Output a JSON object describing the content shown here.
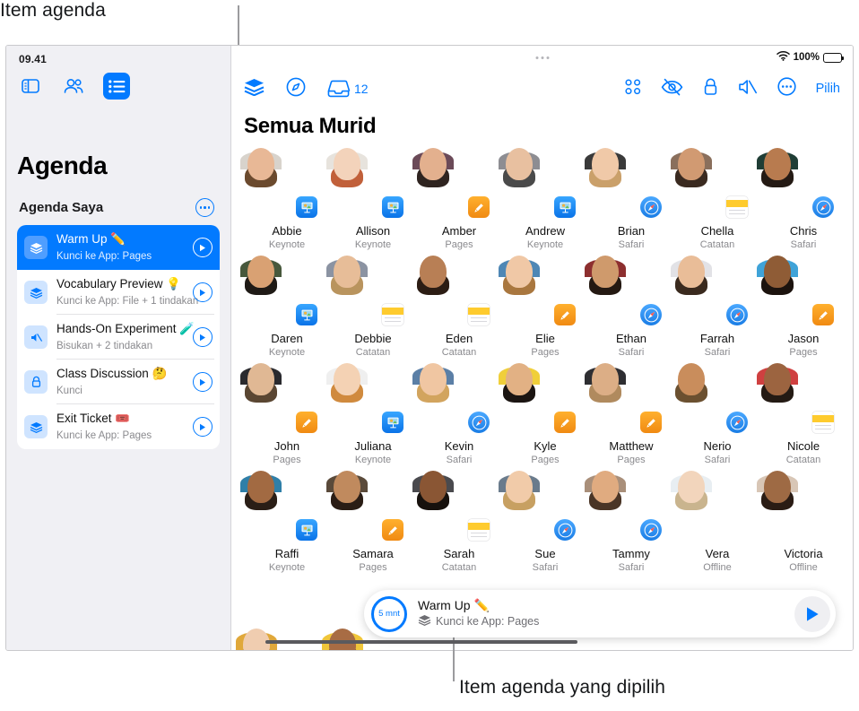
{
  "callouts": {
    "top": "Item agenda",
    "bottom": "Item agenda yang dipilih"
  },
  "sidebar": {
    "status_time": "09.41",
    "toolbar": [
      {
        "name": "sidebar-toggle-icon",
        "label": "Sidebar"
      },
      {
        "name": "people-icon",
        "label": "Murid"
      },
      {
        "name": "list-icon",
        "label": "Agenda"
      }
    ],
    "title": "Agenda",
    "subtitle": "Agenda Saya",
    "more_label": "Lainnya",
    "items": [
      {
        "title": "Warm Up ✏️",
        "subtitle": "Kunci ke App: Pages",
        "icon": "layers-icon",
        "selected": true
      },
      {
        "title": "Vocabulary Preview 💡",
        "subtitle": "Kunci ke App: File + 1 tindakan",
        "icon": "layers-icon",
        "selected": false
      },
      {
        "title": "Hands-On Experiment 🧪",
        "subtitle": "Bisukan + 2 tindakan",
        "icon": "mute-icon",
        "selected": false
      },
      {
        "title": "Class Discussion 🤔",
        "subtitle": "Kunci",
        "icon": "lock-icon",
        "selected": false
      },
      {
        "title": "Exit Ticket 🎟️",
        "subtitle": "Kunci ke App: Pages",
        "icon": "layers-icon",
        "selected": false
      }
    ]
  },
  "main": {
    "status_battery": "100%",
    "toolbar_left": [
      {
        "name": "layers-icon"
      },
      {
        "name": "compass-icon"
      },
      {
        "name": "inbox-icon"
      }
    ],
    "inbox_count": "12",
    "toolbar_right": [
      {
        "name": "grid-view-icon"
      },
      {
        "name": "hide-screen-icon"
      },
      {
        "name": "lock-icon"
      },
      {
        "name": "mute-icon"
      },
      {
        "name": "more-icon"
      }
    ],
    "select_label": "Pilih",
    "title": "Semua Murid",
    "students": [
      {
        "name": "Abbie",
        "app": "Keynote",
        "badge": "keynote",
        "hair": "#6b4a2e",
        "face": "#e8b896",
        "bg": "#9ab98a",
        "body": "#d8d3cc"
      },
      {
        "name": "Allison",
        "app": "Keynote",
        "badge": "keynote",
        "hair": "#c1603a",
        "face": "#f3d3bb",
        "bg": "#b9cfe0",
        "body": "#e7e3dd"
      },
      {
        "name": "Amber",
        "app": "Pages",
        "badge": "pages",
        "hair": "#2f2420",
        "face": "#e3b08e",
        "bg": "#4f5a52",
        "body": "#6b4a58"
      },
      {
        "name": "Andrew",
        "app": "Keynote",
        "badge": "keynote",
        "hair": "#4a4a4a",
        "face": "#e8c0a0",
        "bg": "#a9a9ae",
        "body": "#8d8d92"
      },
      {
        "name": "Brian",
        "app": "Safari",
        "badge": "safari",
        "hair": "#caa06a",
        "face": "#f0c9a8",
        "bg": "#2b2b2b",
        "body": "#3a3a3a"
      },
      {
        "name": "Chella",
        "app": "Catatan",
        "badge": "catatan",
        "hair": "#3a2a20",
        "face": "#d19a72",
        "bg": "#b7ae9a",
        "body": "#8a6f5c"
      },
      {
        "name": "Chris",
        "app": "Safari",
        "badge": "safari",
        "hair": "#241a14",
        "face": "#b87b4f",
        "bg": "#2f4f46",
        "body": "#1f3d35"
      },
      {
        "name": "Daren",
        "app": "Keynote",
        "badge": "keynote",
        "hair": "#1f1a16",
        "face": "#d9a173",
        "bg": "#6f8a5e",
        "body": "#47583c"
      },
      {
        "name": "Debbie",
        "app": "Catatan",
        "badge": "catatan",
        "hair": "#b9945e",
        "face": "#e7bd98",
        "bg": "#5b6270",
        "body": "#8b93a2"
      },
      {
        "name": "Eden",
        "app": "Catatan",
        "badge": "catatan",
        "hair": "#2c1d14",
        "face": "#b87f55",
        "bg": "#d7d2c8",
        "body": "#ffffff"
      },
      {
        "name": "Elie",
        "app": "Pages",
        "badge": "pages",
        "hair": "#a9773f",
        "face": "#f0c8a6",
        "bg": "#7fa25a",
        "body": "#4e87b5"
      },
      {
        "name": "Ethan",
        "app": "Safari",
        "badge": "safari",
        "hair": "#241912",
        "face": "#cf9a6c",
        "bg": "#4a7a3a",
        "body": "#8d2f2f"
      },
      {
        "name": "Farrah",
        "app": "Safari",
        "badge": "safari",
        "hair": "#3a2a1e",
        "face": "#e9bd98",
        "bg": "#cfcfd6",
        "body": "#e2e2e6"
      },
      {
        "name": "Jason",
        "app": "Pages",
        "badge": "pages",
        "hair": "#1c130e",
        "face": "#8f5c36",
        "bg": "#3a2b20",
        "body": "#3fa3d8"
      },
      {
        "name": "John",
        "app": "Pages",
        "badge": "pages",
        "hair": "#5a4632",
        "face": "#e0b894",
        "bg": "#cdc4b6",
        "body": "#2a2a2e"
      },
      {
        "name": "Juliana",
        "app": "Keynote",
        "badge": "keynote",
        "hair": "#d08a3e",
        "face": "#f4d2b4",
        "bg": "#d8d8dd",
        "body": "#efefef"
      },
      {
        "name": "Kevin",
        "app": "Safari",
        "badge": "safari",
        "hair": "#d2a45e",
        "face": "#f0c6a2",
        "bg": "#cfd6cc",
        "body": "#5b7fa6"
      },
      {
        "name": "Kyle",
        "app": "Pages",
        "badge": "pages",
        "hair": "#1b1512",
        "face": "#e2b184",
        "bg": "#c9c0ae",
        "body": "#f0cf3a"
      },
      {
        "name": "Matthew",
        "app": "Pages",
        "badge": "pages",
        "hair": "#b08a5e",
        "face": "#dcae86",
        "bg": "#3c3c40",
        "body": "#2e2e32"
      },
      {
        "name": "Nerio",
        "app": "Safari",
        "badge": "safari",
        "hair": "#6b5030",
        "face": "#c98d5c",
        "bg": "#3f5f35",
        "body": "#ffffff"
      },
      {
        "name": "Nicole",
        "app": "Catatan",
        "badge": "catatan",
        "hair": "#241a14",
        "face": "#9c6440",
        "bg": "#7d7a8c",
        "body": "#cf4040"
      },
      {
        "name": "Raffi",
        "app": "Keynote",
        "badge": "keynote",
        "hair": "#2a1e16",
        "face": "#a26a42",
        "bg": "#cdd3cb",
        "body": "#2f7fa8"
      },
      {
        "name": "Samara",
        "app": "Pages",
        "badge": "pages",
        "hair": "#2a1d15",
        "face": "#c08a5e",
        "bg": "#b8b3a2",
        "body": "#5a4a3a"
      },
      {
        "name": "Sarah",
        "app": "Catatan",
        "badge": "catatan",
        "hair": "#17110d",
        "face": "#8a5634",
        "bg": "#dcdce0",
        "body": "#4a4a4e"
      },
      {
        "name": "Sue",
        "app": "Safari",
        "badge": "safari",
        "hair": "#c7a062",
        "face": "#f1cba9",
        "bg": "#9bb07f",
        "body": "#6a7b8c"
      },
      {
        "name": "Tammy",
        "app": "Safari",
        "badge": "safari",
        "hair": "#4a3526",
        "face": "#e0ab80",
        "bg": "#cbb9a6",
        "body": "#a98f7a"
      },
      {
        "name": "Vera",
        "app": "Offline",
        "badge": "none",
        "hair": "#c9b48e",
        "face": "#f2d5bc",
        "bg": "#cfe0ea",
        "body": "#e8eef2"
      },
      {
        "name": "Victoria",
        "app": "Offline",
        "badge": "none",
        "hair": "#2a1c14",
        "face": "#9e6a44",
        "bg": "#bfb3a6",
        "body": "#d8c6b6"
      }
    ],
    "partial_students": [
      {
        "hair": "#7a4a2e",
        "face": "#f0cdb0",
        "bg": "#c9d2b8",
        "body": "#e0a83a"
      },
      {
        "hair": "#1e1410",
        "face": "#a86c44",
        "bg": "#d9c9a8",
        "body": "#f0c63a"
      }
    ]
  },
  "now_playing": {
    "timer": "5 mnt",
    "title": "Warm Up ✏️",
    "subtitle": "Kunci ke App: Pages",
    "play_label": "Mulai"
  },
  "colors": {
    "accent": "#027aff",
    "sidebar_bg": "#f0f0f4",
    "muted": "#8a8a8e"
  }
}
